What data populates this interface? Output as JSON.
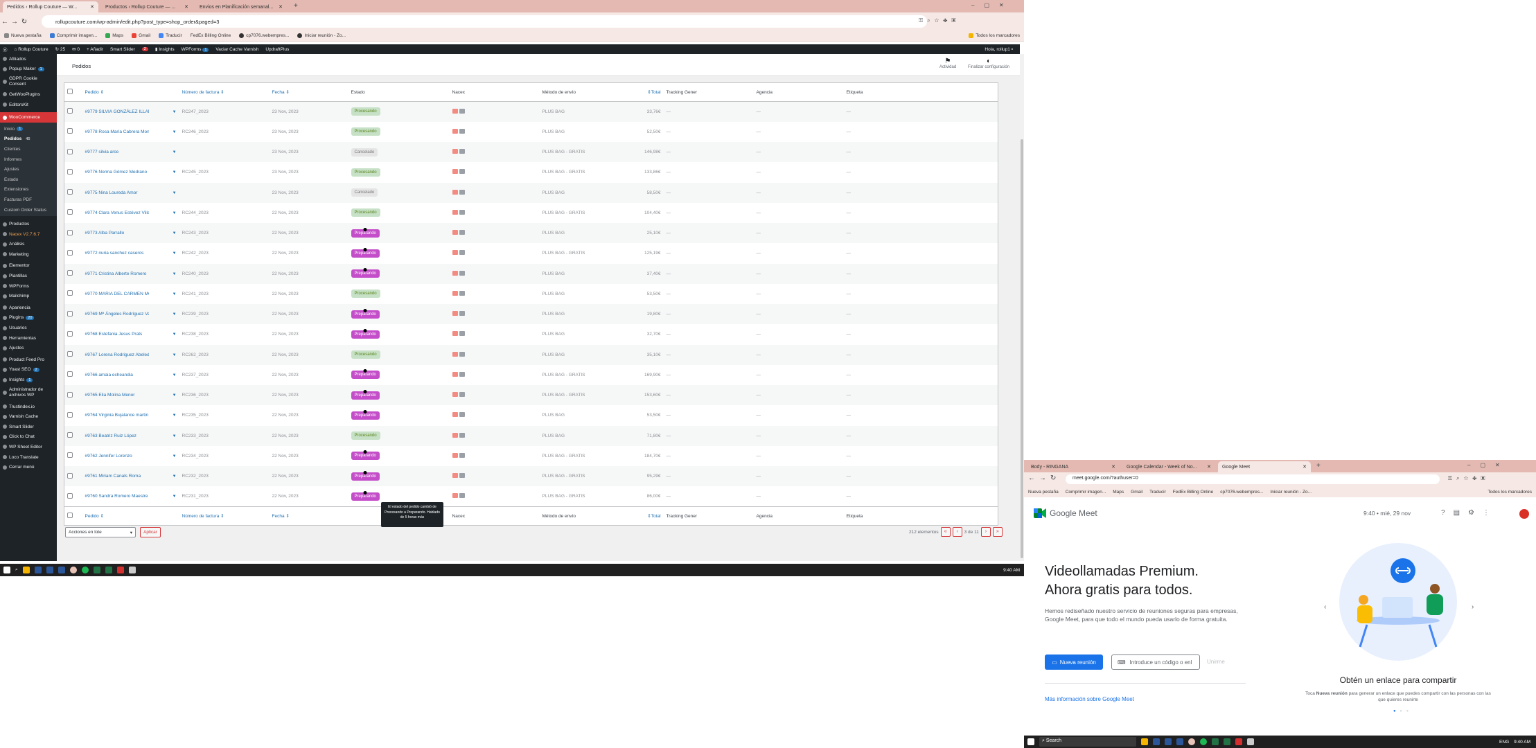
{
  "browser1": {
    "tabs": [
      {
        "label": "Pedidos ‹ Rollup Couture — W..."
      },
      {
        "label": "Productos ‹ Rollup Couture — ..."
      },
      {
        "label": "Envios en Planificación semanal..."
      }
    ],
    "url": "rollupcouture.com/wp-admin/edit.php?post_type=shop_order&paged=3",
    "bookmarks": [
      "Nueva pestaña",
      "Comprimir imagen...",
      "Maps",
      "Gmail",
      "Traducir",
      "FedEx Billing Online",
      "cp7076.webempres...",
      "Iniciar reunión - Zo..."
    ],
    "bookmarks_right": "Todos los marcadores"
  },
  "adminbar": {
    "site": "Rollup Couture",
    "updates": "25",
    "comments": "0",
    "new": "Añadir",
    "smartslider": "Smart Slider",
    "notices": "2",
    "insights": "Insights",
    "wpforms": "WPForms",
    "wpforms_badge": "1",
    "varnish": "Vaciar Cache Varnish",
    "updraft": "UpdraftPlus",
    "greeting": "Hola, rollup1"
  },
  "sidebar": {
    "items": [
      {
        "label": "Afiliados"
      },
      {
        "label": "Popup Maker",
        "badge": "1"
      },
      {
        "label": "GDPR Cookie Consent"
      },
      {
        "label": "GetWooPlugins"
      },
      {
        "label": "EditorsKit"
      }
    ],
    "woocommerce": "WooCommerce",
    "sub": [
      {
        "label": "Inicio",
        "badge": "1"
      },
      {
        "label": "Pedidos",
        "badge": "45"
      },
      {
        "label": "Clientes"
      },
      {
        "label": "Informes"
      },
      {
        "label": "Ajustes"
      },
      {
        "label": "Estado"
      },
      {
        "label": "Extensiones"
      },
      {
        "label": "Facturas PDF"
      },
      {
        "label": "Custom Order Status"
      }
    ],
    "items2": [
      {
        "label": "Productos"
      },
      {
        "label": "Nacex V2.7.6.7"
      },
      {
        "label": "Análisis"
      },
      {
        "label": "Marketing"
      },
      {
        "label": "Elementor"
      },
      {
        "label": "Plantillas"
      },
      {
        "label": "WPForms"
      },
      {
        "label": "Mailchimp"
      },
      {
        "label": "Apariencia"
      },
      {
        "label": "Plugins",
        "badge": "20"
      },
      {
        "label": "Usuarios"
      },
      {
        "label": "Herramientas"
      },
      {
        "label": "Ajustes"
      },
      {
        "label": "Product Feed Pro"
      },
      {
        "label": "Yoast SEO",
        "badge": "2"
      },
      {
        "label": "Insights",
        "badge": "1"
      },
      {
        "label": "Administrador de archivos WP"
      },
      {
        "label": "Trustindex.io"
      },
      {
        "label": "Varnish Cache"
      },
      {
        "label": "Smart Slider"
      },
      {
        "label": "Click to Chat"
      },
      {
        "label": "WP Sheet Editor"
      },
      {
        "label": "Loco Translate"
      },
      {
        "label": "Cerrar menú"
      }
    ]
  },
  "page": {
    "title": "Pedidos",
    "activity": "Actividad",
    "finish": "Finalizar configuración"
  },
  "table": {
    "headers": {
      "order": "Pedido",
      "invoice": "Número de factura",
      "date": "Fecha",
      "status": "Estado",
      "nacex": "Nacex",
      "shipping": "Método de envío",
      "total": "Total",
      "tracking": "Tracking Gener",
      "agency": "Agencia",
      "label": "Etiqueta"
    },
    "rows": [
      {
        "order": "#9779 SILVIA GONZÁLEZ ILLANES",
        "invoice": "RC247_2023",
        "date": "23 Nov, 2023",
        "status": "Procesando",
        "shipping": "PLUS BAG",
        "total": "33,76€"
      },
      {
        "order": "#9778 Rosa María Cabrera Montiel",
        "invoice": "RC246_2023",
        "date": "23 Nov, 2023",
        "status": "Procesando",
        "shipping": "PLUS BAG",
        "total": "52,50€"
      },
      {
        "order": "#9777 silvia arce",
        "invoice": "",
        "date": "23 Nov, 2023",
        "status": "Cancelado",
        "shipping": "PLUS BAG - GRATIS",
        "total": "146,98€"
      },
      {
        "order": "#9776 Norma Gómez Medrano",
        "invoice": "RC245_2023",
        "date": "23 Nov, 2023",
        "status": "Procesando",
        "shipping": "PLUS BAG - GRATIS",
        "total": "133,86€"
      },
      {
        "order": "#9775 Nina Loureda Amor",
        "invoice": "",
        "date": "23 Nov, 2023",
        "status": "Cancelado",
        "shipping": "PLUS BAG",
        "total": "58,50€"
      },
      {
        "order": "#9774 Clara Venus Estévez Villar",
        "invoice": "RC244_2023",
        "date": "22 Nov, 2023",
        "status": "Procesando",
        "shipping": "PLUS BAG - GRATIS",
        "total": "104,40€"
      },
      {
        "order": "#9773 Alba Parrallo",
        "invoice": "RC243_2023",
        "date": "22 Nov, 2023",
        "status": "Preparando",
        "shipping": "PLUS BAG",
        "total": "25,10€"
      },
      {
        "order": "#9772 nuria sanchez caseros",
        "invoice": "RC242_2023",
        "date": "22 Nov, 2023",
        "status": "Preparando",
        "shipping": "PLUS BAG - GRATIS",
        "total": "125,19€"
      },
      {
        "order": "#9771 Cristina Alberte Romero",
        "invoice": "RC240_2023",
        "date": "22 Nov, 2023",
        "status": "Preparando",
        "shipping": "PLUS BAG",
        "total": "37,40€"
      },
      {
        "order": "#9770 MARIA DEL CARMEN MONTEJO LINARES",
        "invoice": "RC241_2023",
        "date": "22 Nov, 2023",
        "status": "Procesando",
        "shipping": "PLUS BAG",
        "total": "53,50€"
      },
      {
        "order": "#9769 Mª Ángeles Rodríguez Valero",
        "invoice": "RC239_2023",
        "date": "22 Nov, 2023",
        "status": "Preparando",
        "shipping": "PLUS BAG",
        "total": "19,80€"
      },
      {
        "order": "#9768 Estefania Jesus Prats",
        "invoice": "RC238_2023",
        "date": "22 Nov, 2023",
        "status": "Preparando",
        "shipping": "PLUS BAG",
        "total": "32,70€"
      },
      {
        "order": "#9767 Lorena Rodriguez Abeledo",
        "invoice": "RC262_2023",
        "date": "22 Nov, 2023",
        "status": "Procesando",
        "shipping": "PLUS BAG",
        "total": "35,10€"
      },
      {
        "order": "#9766 amaia echeandia",
        "invoice": "RC237_2023",
        "date": "22 Nov, 2023",
        "status": "Preparando",
        "shipping": "PLUS BAG - GRATIS",
        "total": "169,90€"
      },
      {
        "order": "#9765 Elia Molina Menor",
        "invoice": "RC236_2023",
        "date": "22 Nov, 2023",
        "status": "Preparando",
        "shipping": "PLUS BAG - GRATIS",
        "total": "153,60€"
      },
      {
        "order": "#9764 Virginia Bujalance martin",
        "invoice": "RC235_2023",
        "date": "22 Nov, 2023",
        "status": "Preparando",
        "shipping": "PLUS BAG",
        "total": "53,50€"
      },
      {
        "order": "#9763 Beatriz Ruiz López",
        "invoice": "RC233_2023",
        "date": "22 Nov, 2023",
        "status": "Procesando",
        "shipping": "PLUS BAG",
        "total": "71,80€"
      },
      {
        "order": "#9762 Jennifer Lorenzo",
        "invoice": "RC234_2023",
        "date": "22 Nov, 2023",
        "status": "Preparando",
        "shipping": "PLUS BAG - GRATIS",
        "total": "184,70€"
      },
      {
        "order": "#9761 Miriam Canals Roma",
        "invoice": "RC232_2023",
        "date": "22 Nov, 2023",
        "status": "Preparando",
        "shipping": "PLUS BAG - GRATIS",
        "total": "95,29€"
      },
      {
        "order": "#9760 Sandra Romero Maestre",
        "invoice": "RC231_2023",
        "date": "22 Nov, 2023",
        "status": "Preparando",
        "shipping": "PLUS BAG - GRATIS",
        "total": "86,00€"
      }
    ],
    "dash": "—"
  },
  "tooltip": "El estado del pedido cambió de Procesando a Preparando. Hablado de 5 horas más",
  "bulk": {
    "select": "Acciones en lote",
    "apply": "Aplicar"
  },
  "pagination": {
    "count": "212 elementos",
    "first": "«",
    "prev": "‹",
    "current": "3 de 11",
    "next": "›",
    "last": "»"
  },
  "taskbar1": {
    "time": "9:40 AM"
  },
  "browser2": {
    "tabs": [
      {
        "label": "Body - RINGANA"
      },
      {
        "label": "Google Calendar - Week of No..."
      },
      {
        "label": "Google Meet"
      }
    ],
    "url": "meet.google.com/?authuser=0",
    "bookmarks": [
      "Nueva pestaña",
      "Comprimir imagen...",
      "Maps",
      "Gmail",
      "Traducir",
      "FedEx Billing Online",
      "cp7076.webempres...",
      "Iniciar reunión - Zo..."
    ],
    "bookmarks_right": "Todos los marcadores"
  },
  "meet": {
    "brand": "Google Meet",
    "time": "9:40 • mié, 29 nov",
    "h1_line1": "Videollamadas Premium.",
    "h1_line2": "Ahora gratis para todos.",
    "desc": "Hemos rediseñado nuestro servicio de reuniones seguras para empresas, Google Meet, para que todo el mundo pueda usarlo de forma gratuita.",
    "new_meeting": "Nueva reunión",
    "code_placeholder": "Introduce un código o enl",
    "join": "Unirme",
    "more": "Más información sobre Google Meet",
    "caption": "Obtén un enlace para compartir",
    "caption_sub_1": "Toca",
    "caption_sub_bold": "Nueva reunión",
    "caption_sub_2": "para generar un enlace que puedes compartir con las personas con las que quieres reunirte"
  },
  "taskbar2": {
    "search": "Search",
    "lang": "ENG",
    "time": "9:40 AM"
  },
  "colors": {
    "wp_dark": "#1d2327",
    "woo_red": "#d63638",
    "link": "#2271b1",
    "prep": "#c44ec9",
    "proc_bg": "#c6e1c6",
    "meet_blue": "#1a73e8"
  }
}
